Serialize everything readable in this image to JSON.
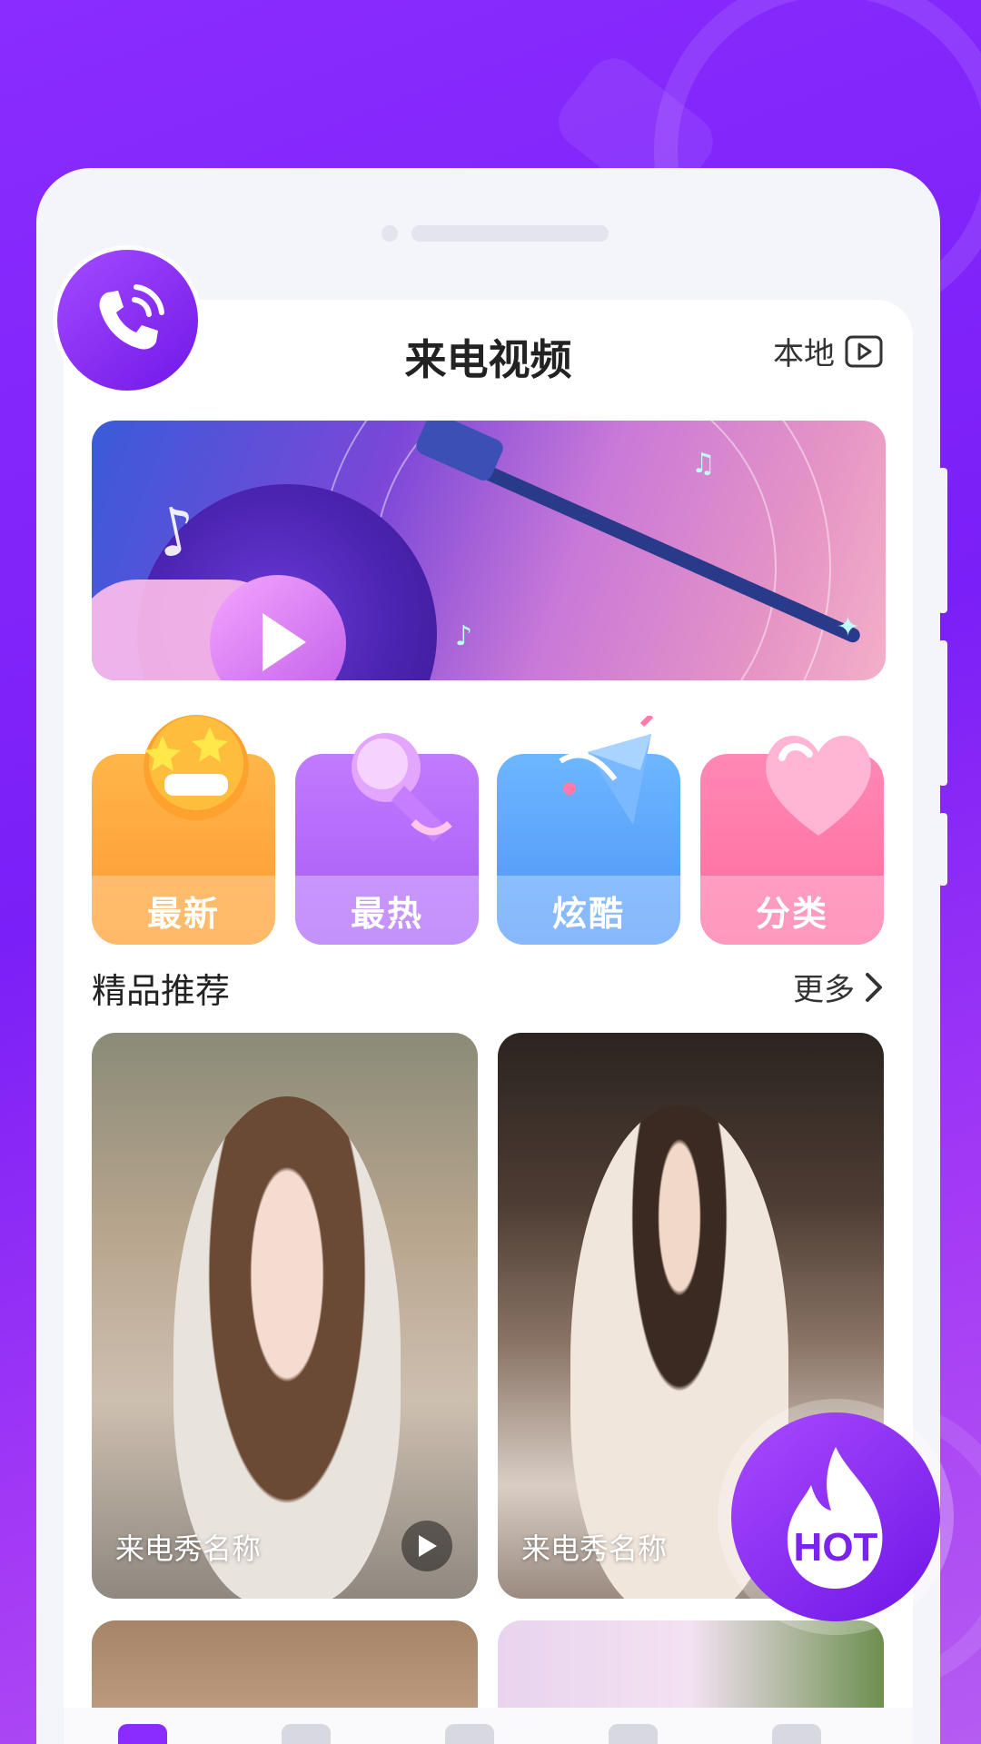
{
  "header": {
    "title": "来电视频",
    "local_label": "本地"
  },
  "categories": [
    {
      "label": "最新"
    },
    {
      "label": "最热"
    },
    {
      "label": "炫酷"
    },
    {
      "label": "分类"
    }
  ],
  "section": {
    "title": "精品推荐",
    "more_label": "更多"
  },
  "tiles": [
    {
      "name": "来电秀名称"
    },
    {
      "name": "来电秀名称"
    }
  ],
  "fab": {
    "label": "HOT"
  },
  "colors": {
    "brand": "#7a1ff7",
    "accent": "#8a2cff"
  }
}
